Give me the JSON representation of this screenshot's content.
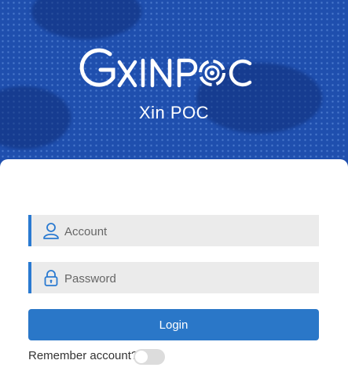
{
  "header": {
    "logo_text": "GxINPOC",
    "subtitle": "Xin POC"
  },
  "form": {
    "account_placeholder": "Account",
    "password_placeholder": "Password",
    "login_label": "Login",
    "remember_label": "Remember account?",
    "remember_checked": false
  },
  "colors": {
    "header_bg": "#1f4fae",
    "accent": "#2a77c8",
    "field_bg": "#ebebeb"
  }
}
